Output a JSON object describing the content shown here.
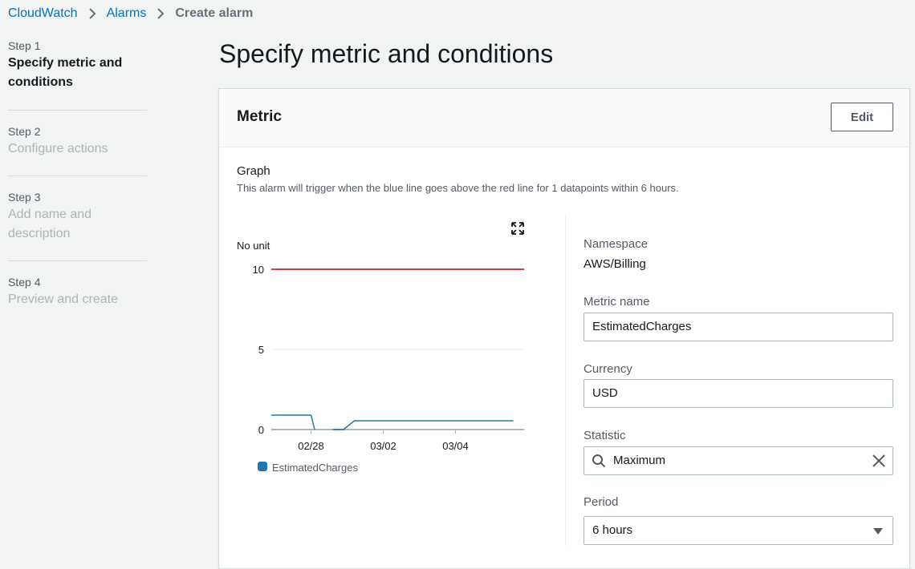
{
  "breadcrumb": {
    "items": [
      "CloudWatch",
      "Alarms"
    ],
    "current": "Create alarm"
  },
  "steps": [
    {
      "num": "Step 1",
      "title": "Specify metric and conditions"
    },
    {
      "num": "Step 2",
      "title": "Configure actions"
    },
    {
      "num": "Step 3",
      "title": "Add name and description"
    },
    {
      "num": "Step 4",
      "title": "Preview and create"
    }
  ],
  "page_title": "Specify metric and conditions",
  "panel": {
    "title": "Metric",
    "edit_label": "Edit",
    "graph_label": "Graph",
    "graph_desc": "This alarm will trigger when the blue line goes above the red line for 1 datapoints within 6 hours."
  },
  "form": {
    "namespace_label": "Namespace",
    "namespace_value": "AWS/Billing",
    "metric_name_label": "Metric name",
    "metric_name_value": "EstimatedCharges",
    "currency_label": "Currency",
    "currency_value": "USD",
    "statistic_label": "Statistic",
    "statistic_value": "Maximum",
    "period_label": "Period",
    "period_value": "6 hours"
  },
  "colors": {
    "link": "#0073bb",
    "series": "#1f77b4",
    "threshold": "#c4262e"
  },
  "chart_data": {
    "type": "line",
    "ylabel": "No unit",
    "ylim": [
      0,
      10
    ],
    "yticks": [
      0,
      5,
      10
    ],
    "xticks": [
      "02/28",
      "03/02",
      "03/04"
    ],
    "x_range_days": [
      -1.1,
      5.9
    ],
    "threshold": 10,
    "series": [
      {
        "name": "EstimatedCharges",
        "points": [
          [
            -1.1,
            0.9
          ],
          [
            0.0,
            0.9
          ],
          [
            0.1,
            0.0
          ],
          [
            0.15,
            null
          ],
          [
            0.6,
            0.0
          ],
          [
            0.9,
            0.0
          ],
          [
            1.2,
            0.55
          ],
          [
            5.6,
            0.55
          ]
        ]
      }
    ],
    "grid": true,
    "legend": "bottom-left"
  }
}
